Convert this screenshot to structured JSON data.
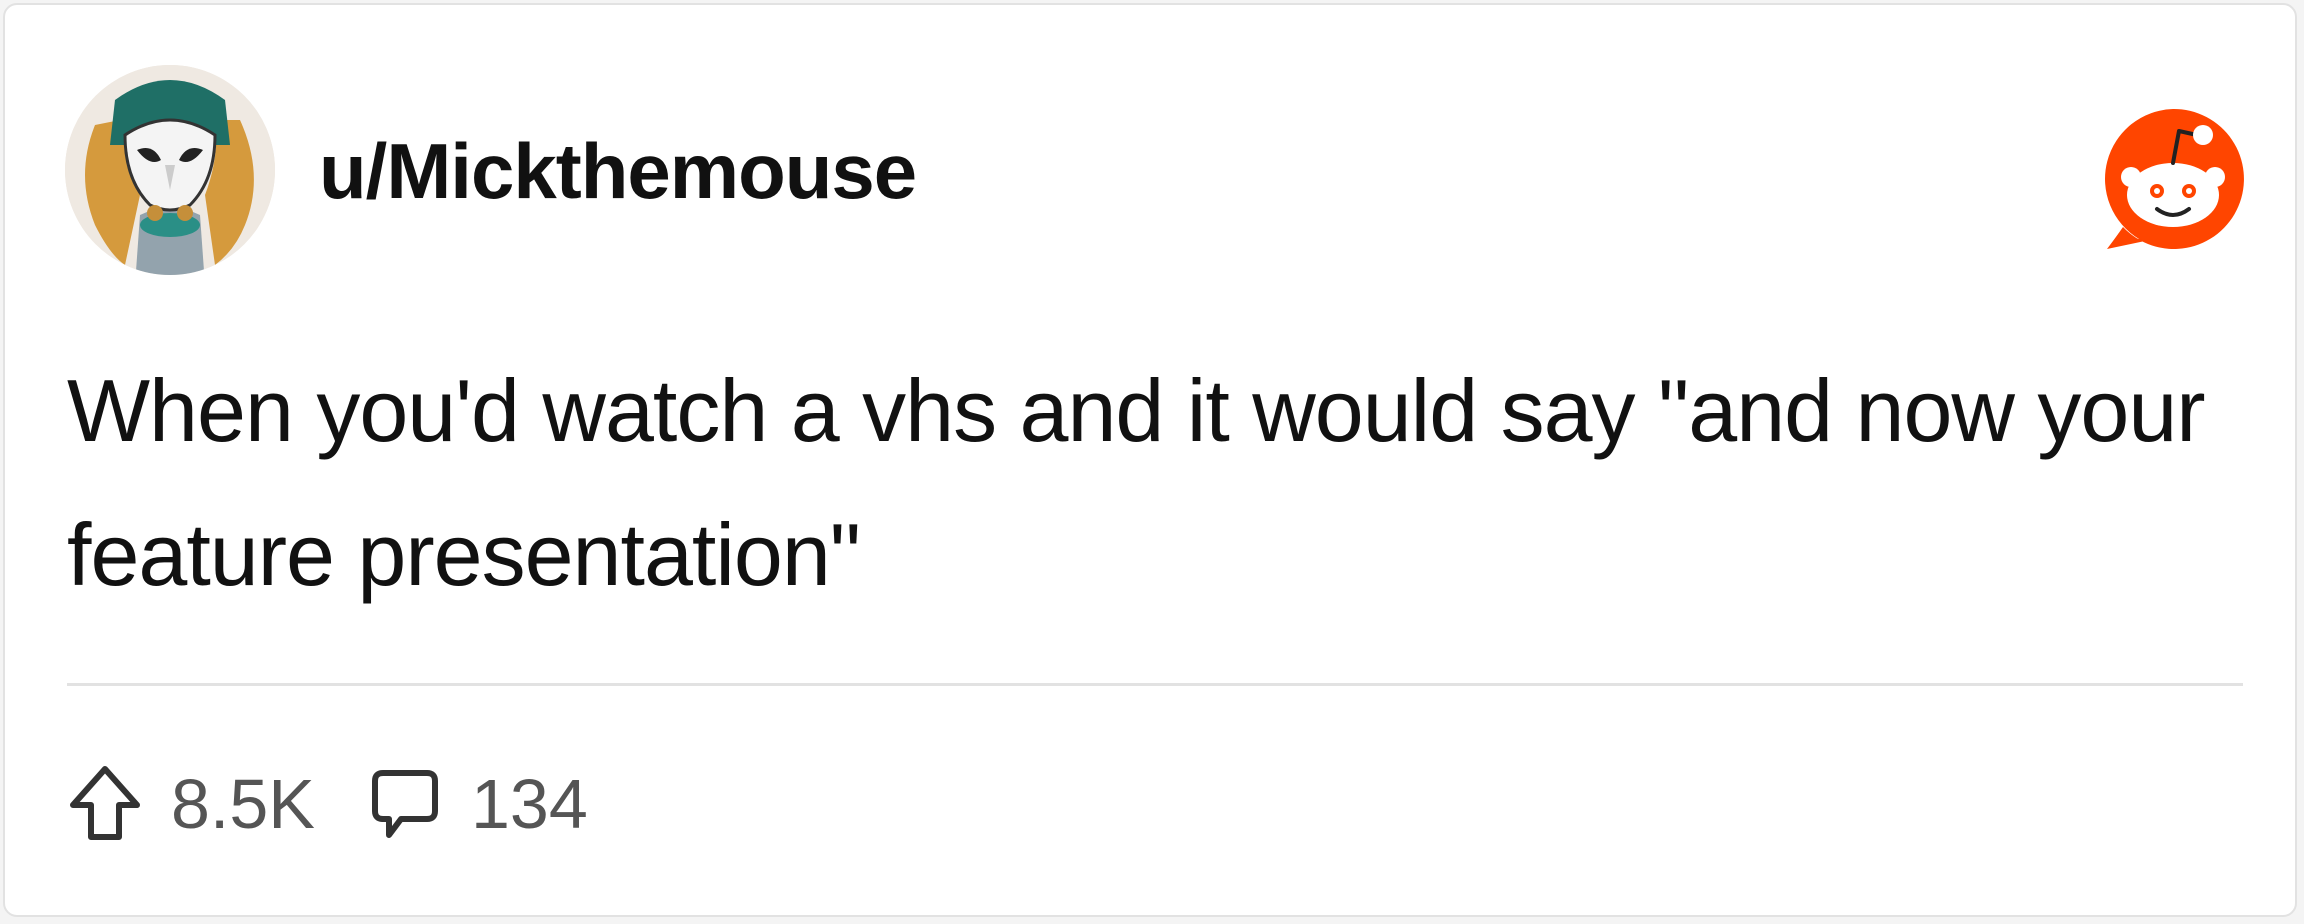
{
  "post": {
    "username": "u/Mickthemouse",
    "text": "When you'd watch a vhs and it would say \"and now your feature presentation\"",
    "upvotes": "8.5K",
    "comments": "134"
  },
  "icons": {
    "avatar": "avatar-icon",
    "brand": "reddit-logo-icon",
    "upvote": "upvote-arrow-icon",
    "comment": "comment-bubble-icon"
  },
  "colors": {
    "brand": "#ff4500",
    "text": "#111111",
    "muted": "#555555",
    "divider": "#e2e2e2"
  }
}
